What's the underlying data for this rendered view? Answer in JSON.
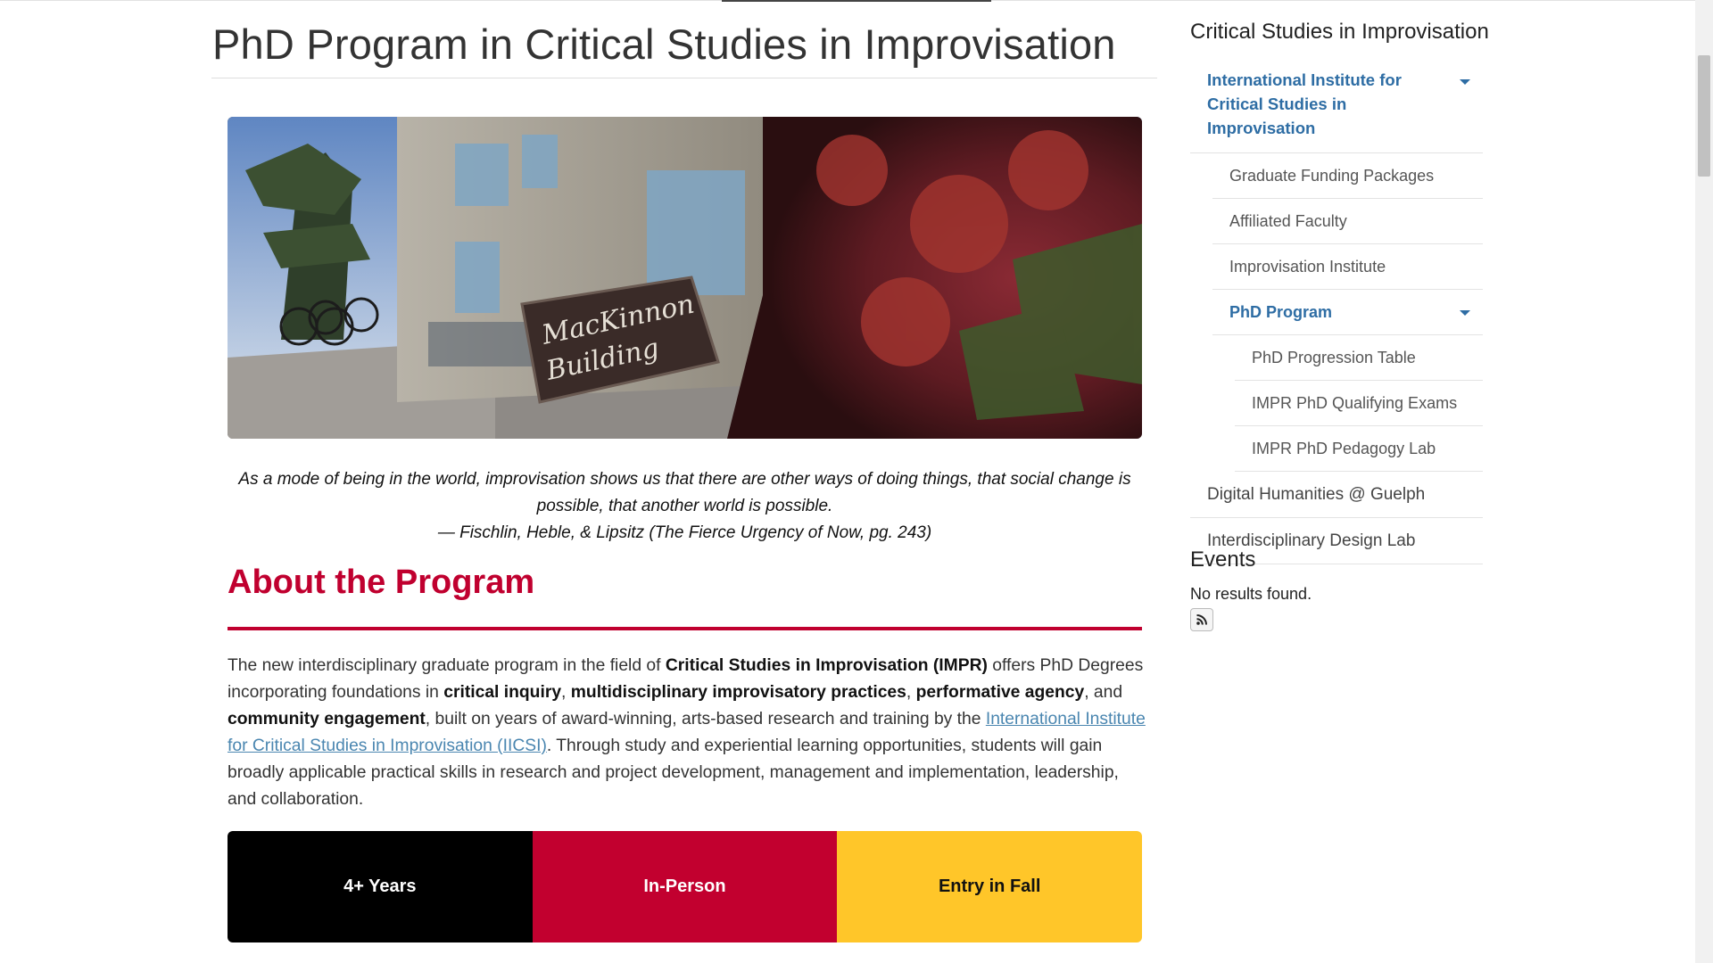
{
  "main": {
    "title": "PhD Program in Critical Studies in Improvisation",
    "hero": {
      "sign_line1": "MacKinnon",
      "sign_line2": "Building"
    },
    "quote": {
      "text": "As a mode of being in the world, improvisation shows us that there are other ways of doing things, that social change is possible, that another world is possible.",
      "author": "— Fischlin, Heble, & Lipsitz (The Fierce Urgency of Now, pg. 243)"
    },
    "section_heading": "About the Program",
    "body": {
      "t1": "The new interdisciplinary graduate program in the field of ",
      "b1": "Critical Studies in Improvisation (IMPR)",
      "t2": " offers PhD Degrees incorporating foundations in ",
      "b2": "critical inquiry",
      "t3": ", ",
      "b3": "multidisciplinary improvisatory practices",
      "t4": ", ",
      "b4": "performative agency",
      "t5": ", and ",
      "b5": "community engagement",
      "t6": ", built on years of award-winning, arts-based research and training by the ",
      "link": "International Institute for Critical Studies in Improvisation (IICSI)",
      "t7": ". Through study and experiential learning opportunities, students will gain broadly applicable practical skills in research and project development, management and implementation, leadership, and collaboration."
    },
    "stats": [
      "4+ Years",
      "In-Person",
      "Entry in Fall"
    ]
  },
  "sidebar": {
    "title": "Critical Studies in Improvisation",
    "nav": {
      "iicsi": "International Institute for Critical Studies in Improvisation",
      "funding": "Graduate Funding Packages",
      "faculty": "Affiliated Faculty",
      "institute": "Improvisation Institute",
      "phd": "PhD Program",
      "progression": "PhD Progression Table",
      "exams": "IMPR PhD Qualifying Exams",
      "pedagogy": "IMPR PhD Pedagogy Lab",
      "dh": "Digital Humanities @ Guelph",
      "design": "Interdisciplinary Design Lab"
    },
    "events": {
      "title": "Events",
      "empty": "No results found."
    }
  },
  "colors": {
    "accent_red": "#c0002f",
    "link_blue": "#2e6da4",
    "stat_black": "#000000",
    "stat_red": "#c2002f",
    "stat_yellow": "#ffc629"
  },
  "icons": {
    "rss": "rss-icon",
    "caret": "caret-down-icon"
  }
}
